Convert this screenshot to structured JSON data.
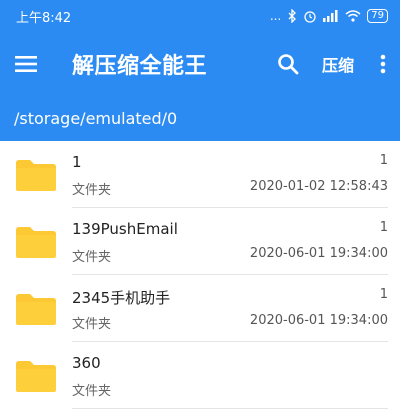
{
  "status_bar": {
    "time": "上午8:42",
    "icons_text": "...",
    "battery": "79",
    "colors": {
      "bar": "#2b8bf2"
    }
  },
  "toolbar": {
    "title": "解压缩全能王",
    "compress_label": "压缩",
    "icons": [
      "menu-icon",
      "search-icon",
      "more-vert-icon"
    ]
  },
  "path_bar": {
    "path": "/storage/emulated/0"
  },
  "files": [
    {
      "name": "1",
      "type": "文件夹",
      "count": "1",
      "date": "2020-01-02 12:58:43"
    },
    {
      "name": "139PushEmail",
      "type": "文件夹",
      "count": "1",
      "date": "2020-06-01 19:34:00"
    },
    {
      "name": "2345手机助手",
      "type": "文件夹",
      "count": "1",
      "date": "2020-06-01 19:34:00"
    },
    {
      "name": "360",
      "type": "文件夹",
      "count": "",
      "date": ""
    }
  ],
  "colors": {
    "accent": "#2b8bf2",
    "folder": "#fcc934"
  }
}
